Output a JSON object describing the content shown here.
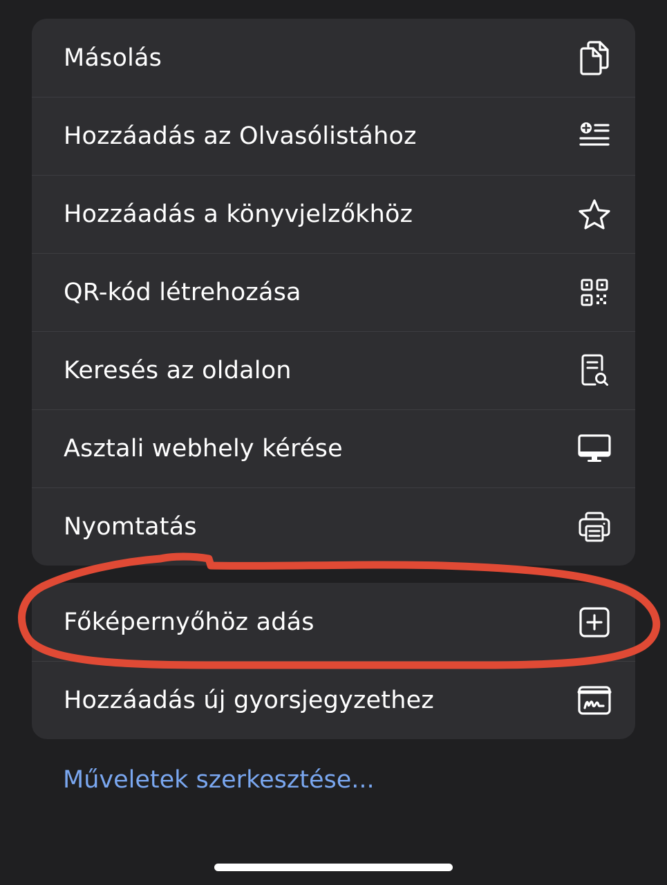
{
  "menu": {
    "group1": [
      {
        "label": "Másolás",
        "icon": "copy-icon"
      },
      {
        "label": "Hozzáadás az Olvasólistához",
        "icon": "reading-list-add-icon"
      },
      {
        "label": "Hozzáadás a könyvjelzőkhöz",
        "icon": "star-icon"
      },
      {
        "label": "QR-kód létrehozása",
        "icon": "qr-code-icon"
      },
      {
        "label": "Keresés az oldalon",
        "icon": "find-on-page-icon"
      },
      {
        "label": "Asztali webhely kérése",
        "icon": "desktop-icon"
      },
      {
        "label": "Nyomtatás",
        "icon": "printer-icon"
      }
    ],
    "group2": [
      {
        "label": "Főképernyőhöz adás",
        "icon": "plus-square-icon"
      },
      {
        "label": "Hozzáadás új gyorsjegyzethez",
        "icon": "quick-note-icon"
      }
    ]
  },
  "edit_actions_label": "Műveletek szerkesztése...",
  "colors": {
    "background": "#1f1f21",
    "menu_surface": "#2e2e31",
    "link": "#7aa7f0",
    "annotation": "#e04a35"
  }
}
